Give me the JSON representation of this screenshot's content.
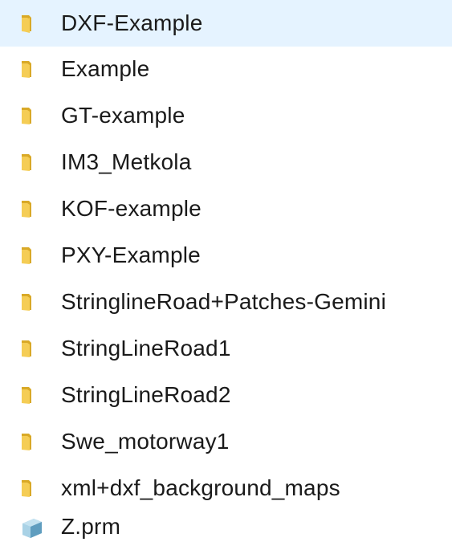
{
  "explorer": {
    "items": [
      {
        "name": "DXF-Example",
        "icon": "folder-icon"
      },
      {
        "name": "Example",
        "icon": "folder-icon"
      },
      {
        "name": "GT-example",
        "icon": "folder-icon"
      },
      {
        "name": "IM3_Metkola",
        "icon": "folder-icon"
      },
      {
        "name": "KOF-example",
        "icon": "folder-icon"
      },
      {
        "name": "PXY-Example",
        "icon": "folder-icon"
      },
      {
        "name": "StringlineRoad+Patches-Gemini",
        "icon": "folder-icon"
      },
      {
        "name": "StringLineRoad1",
        "icon": "folder-icon"
      },
      {
        "name": "StringLineRoad2",
        "icon": "folder-icon"
      },
      {
        "name": "Swe_motorway1",
        "icon": "folder-icon"
      },
      {
        "name": "xml+dxf_background_maps",
        "icon": "folder-icon"
      },
      {
        "name": "Z.prm",
        "icon": "prm-file-icon"
      }
    ]
  },
  "colors": {
    "folder_back": "#d9a927",
    "folder_front": "#f2c94c",
    "text": "#1a1a1a"
  }
}
